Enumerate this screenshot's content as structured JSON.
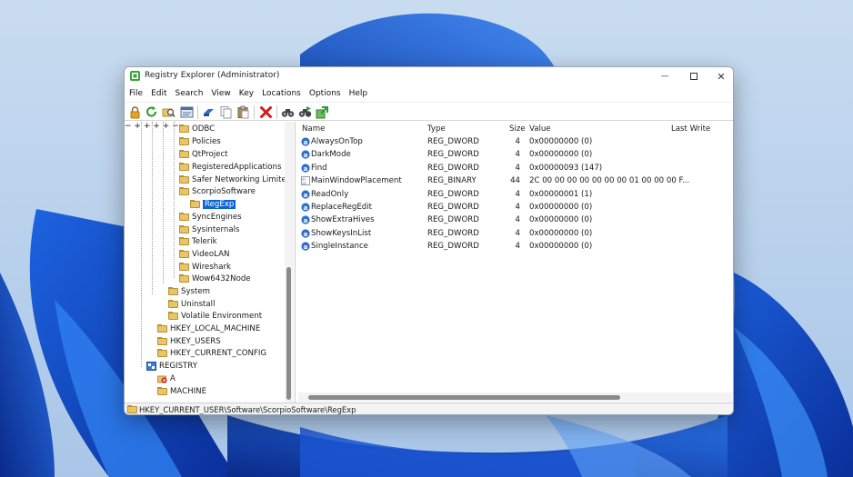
{
  "window": {
    "title": "Registry Explorer (Administrator)",
    "controls": {
      "minimize": "—",
      "close": "✕"
    }
  },
  "menu": [
    "File",
    "Edit",
    "Search",
    "View",
    "Key",
    "Locations",
    "Options",
    "Help"
  ],
  "toolbar": [
    {
      "name": "lock-icon",
      "color": "#e2a521"
    },
    {
      "name": "refresh-icon",
      "color": "#2e9a2e"
    },
    {
      "name": "find-icon",
      "color": "#c99a3a"
    },
    {
      "name": "hex-editor-icon",
      "color": "#4f6f98"
    },
    {
      "name": "goto-key-icon",
      "color": "#2f6fc9"
    },
    {
      "name": "copy-icon",
      "color": "#9a9a9a"
    },
    {
      "name": "paste-icon",
      "color": "#a88a55"
    },
    {
      "name": "delete-icon",
      "color": "#d21a1a"
    },
    {
      "name": "binoculars-find-icon",
      "color": "#444444"
    },
    {
      "name": "binoculars-find-next-icon",
      "color": "#444444"
    },
    {
      "name": "export-icon",
      "color": "#2f9a3a"
    }
  ],
  "tree": [
    {
      "label": "ODBC"
    },
    {
      "label": "Policies"
    },
    {
      "label": "QtProject"
    },
    {
      "label": "RegisteredApplications"
    },
    {
      "label": "Safer Networking Limited"
    },
    {
      "label": "ScorpioSoftware"
    },
    {
      "label": "RegExp",
      "selected": true
    },
    {
      "label": "SyncEngines"
    },
    {
      "label": "Sysinternals"
    },
    {
      "label": "Telerik"
    },
    {
      "label": "VideoLAN"
    },
    {
      "label": "Wireshark"
    },
    {
      "label": "Wow6432Node"
    },
    {
      "label": "System"
    },
    {
      "label": "Uninstall"
    },
    {
      "label": "Volatile Environment"
    },
    {
      "label": "HKEY_LOCAL_MACHINE"
    },
    {
      "label": "HKEY_USERS"
    },
    {
      "label": "HKEY_CURRENT_CONFIG"
    },
    {
      "label": "REGISTRY"
    },
    {
      "label": "A"
    },
    {
      "label": "MACHINE"
    }
  ],
  "list": {
    "columns": [
      "Name",
      "Type",
      "Size",
      "Value",
      "Last Write"
    ],
    "rows": [
      {
        "name": "AlwaysOnTop",
        "type": "REG_DWORD",
        "size": "4",
        "value": "0x00000000 (0)",
        "kind": "dword"
      },
      {
        "name": "DarkMode",
        "type": "REG_DWORD",
        "size": "4",
        "value": "0x00000000 (0)",
        "kind": "dword"
      },
      {
        "name": "Find",
        "type": "REG_DWORD",
        "size": "4",
        "value": "0x00000093 (147)",
        "kind": "dword"
      },
      {
        "name": "MainWindowPlacement",
        "type": "REG_BINARY",
        "size": "44",
        "value": "2C 00 00 00 00 00 00 00 01 00 00 00 F...",
        "kind": "binary"
      },
      {
        "name": "ReadOnly",
        "type": "REG_DWORD",
        "size": "4",
        "value": "0x00000001 (1)",
        "kind": "dword"
      },
      {
        "name": "ReplaceRegEdit",
        "type": "REG_DWORD",
        "size": "4",
        "value": "0x00000000 (0)",
        "kind": "dword"
      },
      {
        "name": "ShowExtraHives",
        "type": "REG_DWORD",
        "size": "4",
        "value": "0x00000000 (0)",
        "kind": "dword"
      },
      {
        "name": "ShowKeysInList",
        "type": "REG_DWORD",
        "size": "4",
        "value": "0x00000000 (0)",
        "kind": "dword"
      },
      {
        "name": "SingleInstance",
        "type": "REG_DWORD",
        "size": "4",
        "value": "0x00000000 (0)",
        "kind": "dword"
      }
    ]
  },
  "status": {
    "path": "HKEY_CURRENT_USER\\Software\\ScorpioSoftware\\RegExp"
  },
  "colors": {
    "selection": "#0a64d6",
    "folder": "#e8c46a",
    "value_icon": "#2f6fc9",
    "wallpaper_dark": "#0a3ea8",
    "wallpaper_light": "#b9d3ee"
  }
}
